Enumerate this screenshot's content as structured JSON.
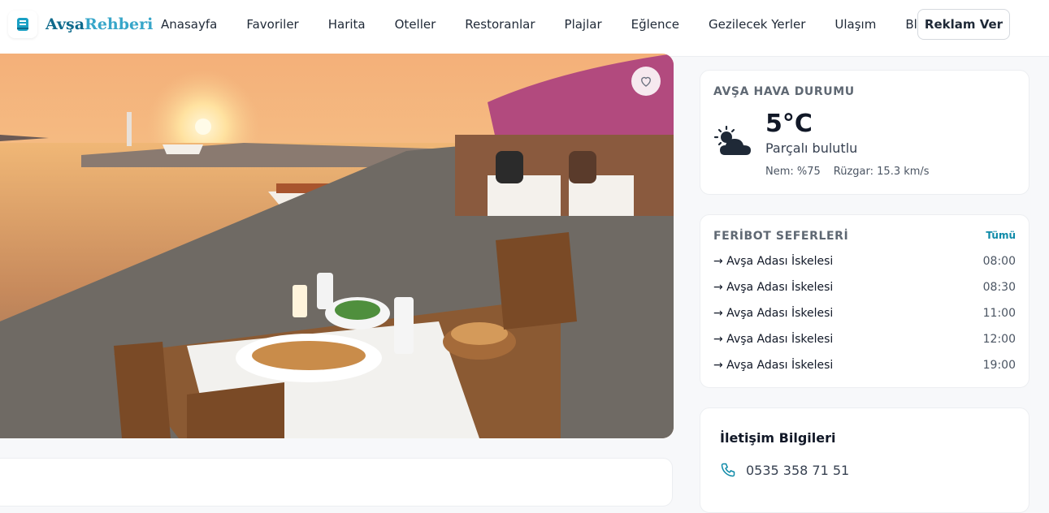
{
  "brand": {
    "part1": "Avşa",
    "part2": "Rehberi"
  },
  "nav": {
    "items": [
      "Anasayfa",
      "Favoriler",
      "Harita",
      "Oteller",
      "Restoranlar",
      "Plajlar",
      "Eğlence",
      "Gezilecek Yerler",
      "Ulaşım",
      "Blog"
    ],
    "cta": "Reklam Ver"
  },
  "weather": {
    "title": "AVŞA HAVA DURUMU",
    "temp": "5°C",
    "desc": "Parçalı bulutlu",
    "humidity": "Nem: %75",
    "wind": "Rüzgar: 15.3 km/s",
    "icon": "partly-cloudy-icon"
  },
  "ferry": {
    "title": "FERİBOT SEFERLERİ",
    "all_label": "Tümü",
    "rows": [
      {
        "dest": "→ Avşa Adası İskelesi",
        "time": "08:00"
      },
      {
        "dest": "→ Avşa Adası İskelesi",
        "time": "08:30"
      },
      {
        "dest": "→ Avşa Adası İskelesi",
        "time": "11:00"
      },
      {
        "dest": "→ Avşa Adası İskelesi",
        "time": "12:00"
      },
      {
        "dest": "→ Avşa Adası İskelesi",
        "time": "19:00"
      }
    ]
  },
  "contact": {
    "title": "İletişim Bilgileri",
    "phone": "0535 358 71 51"
  },
  "colors": {
    "brand_dark": "#0e6a8c",
    "brand_light": "#37a6c9",
    "accent": "#0e8aa8"
  }
}
